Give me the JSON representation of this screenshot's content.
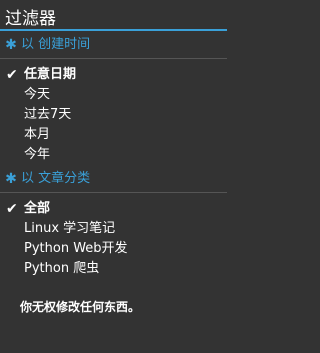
{
  "panel": {
    "title": "过滤器"
  },
  "sections": [
    {
      "heading": "以 创建时间",
      "items": [
        {
          "label": "任意日期",
          "active": true
        },
        {
          "label": "今天",
          "active": false
        },
        {
          "label": "过去7天",
          "active": false
        },
        {
          "label": "本月",
          "active": false
        },
        {
          "label": "今年",
          "active": false
        }
      ]
    },
    {
      "heading": "以 文章分类",
      "items": [
        {
          "label": "全部",
          "active": true
        },
        {
          "label": "Linux 学习笔记",
          "active": false
        },
        {
          "label": "Python Web开发",
          "active": false
        },
        {
          "label": "Python 爬虫",
          "active": false
        }
      ]
    }
  ],
  "footer_note": "你无权修改任何东西。",
  "colors": {
    "background": "#333333",
    "accent": "#3aa0d8",
    "text": "#ffffff"
  },
  "icons": {
    "section": "asterisk-icon",
    "selected": "checkmark-icon"
  }
}
